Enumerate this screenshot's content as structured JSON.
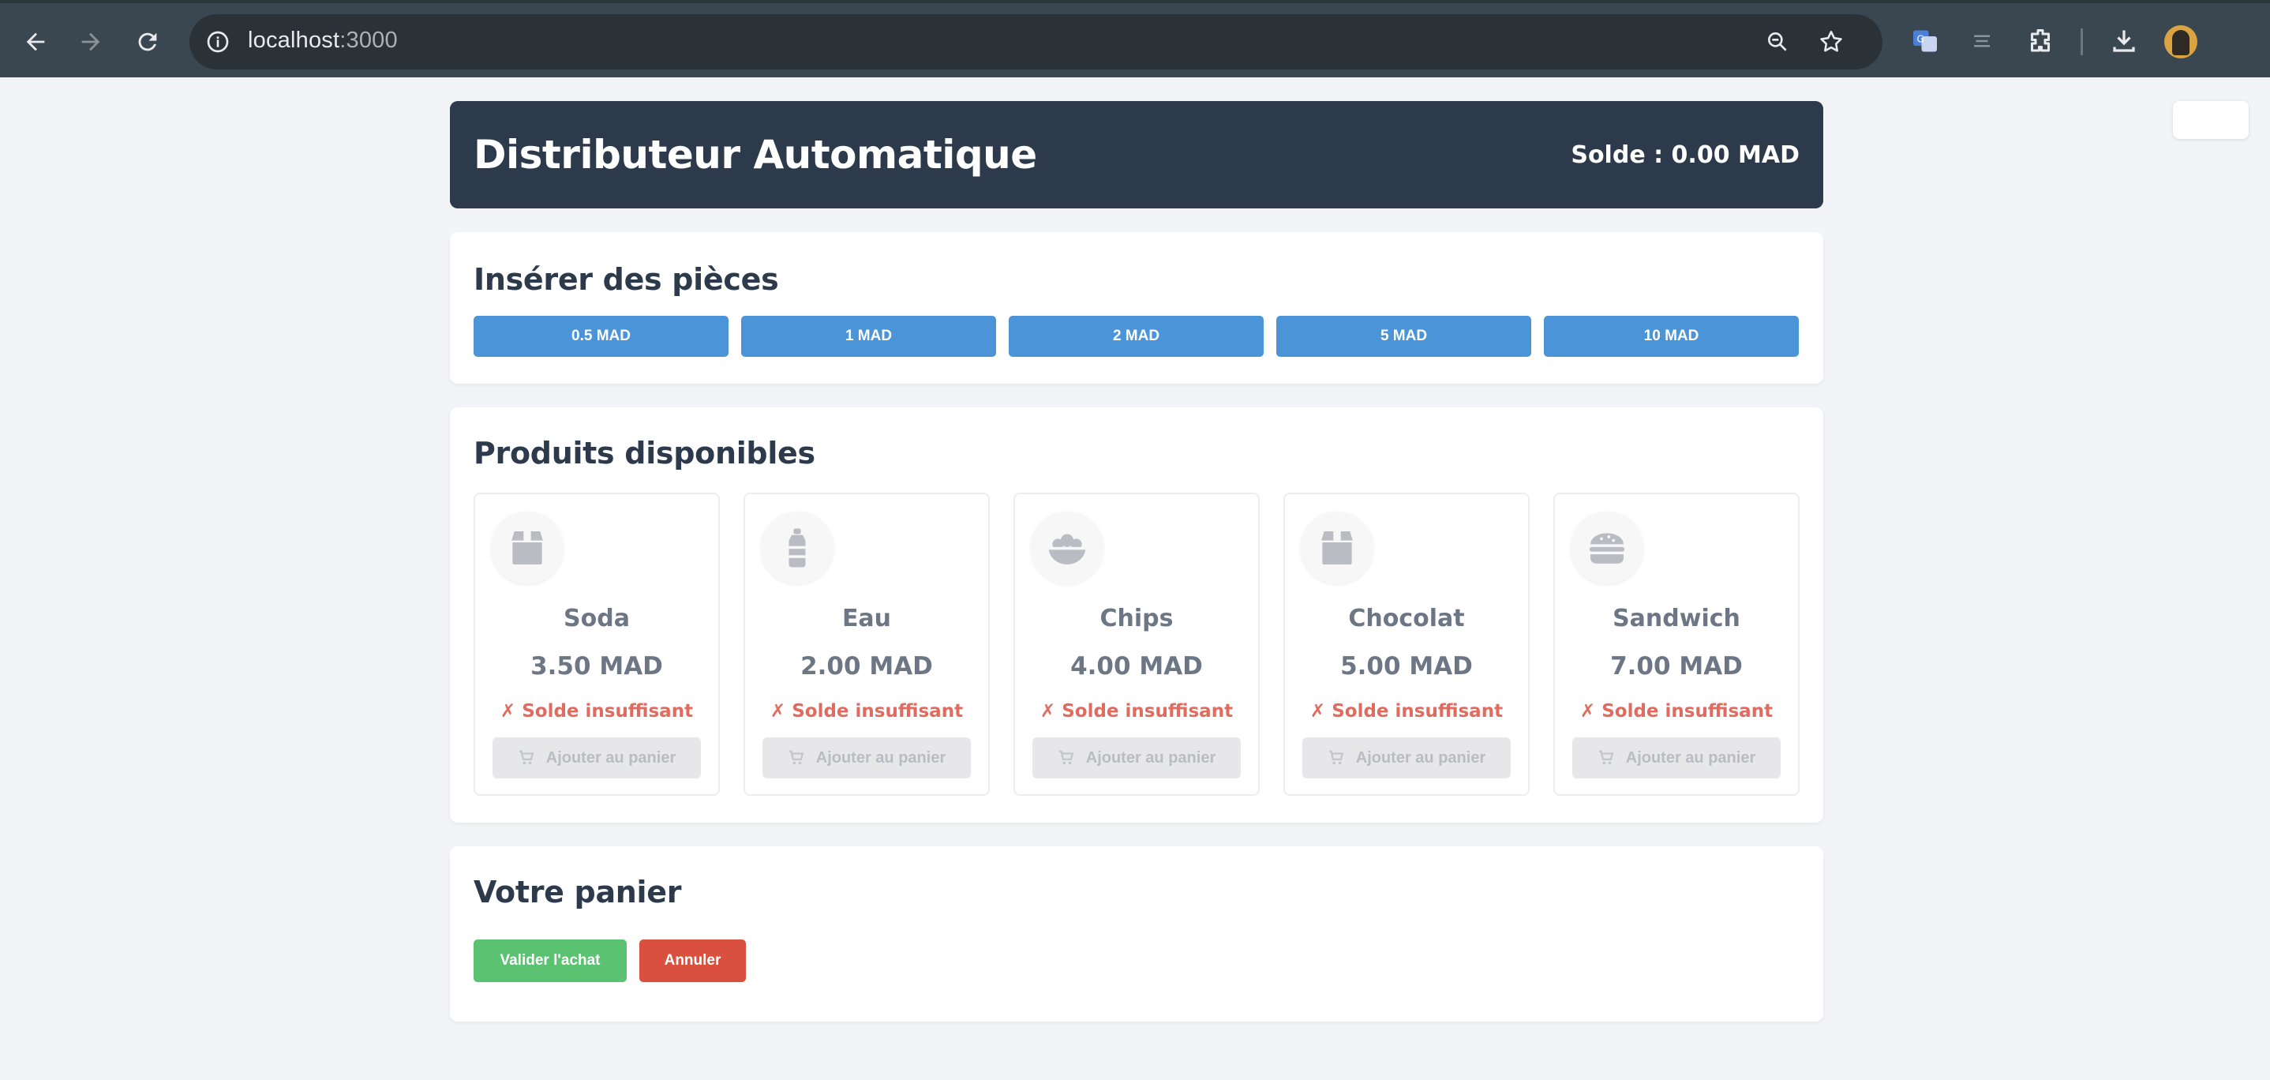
{
  "browser": {
    "url_host": "localhost",
    "url_port": ":3000"
  },
  "app": {
    "title": "Distributeur Automatique",
    "balance": "Solde : 0.00 MAD"
  },
  "coins": {
    "title": "Insérer des pièces",
    "buttons": [
      "0.5 MAD",
      "1 MAD",
      "2 MAD",
      "5 MAD",
      "10 MAD"
    ]
  },
  "products": {
    "title": "Produits disponibles",
    "items": [
      {
        "name": "Soda",
        "price": "3.50 MAD",
        "status": "✗ Solde insuffisant",
        "add_label": "Ajouter au panier",
        "icon": "box-icon"
      },
      {
        "name": "Eau",
        "price": "2.00 MAD",
        "status": "✗ Solde insuffisant",
        "add_label": "Ajouter au panier",
        "icon": "bottle-icon"
      },
      {
        "name": "Chips",
        "price": "4.00 MAD",
        "status": "✗ Solde insuffisant",
        "add_label": "Ajouter au panier",
        "icon": "bowl-icon"
      },
      {
        "name": "Chocolat",
        "price": "5.00 MAD",
        "status": "✗ Solde insuffisant",
        "add_label": "Ajouter au panier",
        "icon": "box-icon"
      },
      {
        "name": "Sandwich",
        "price": "7.00 MAD",
        "status": "✗ Solde insuffisant",
        "add_label": "Ajouter au panier",
        "icon": "burger-icon"
      }
    ]
  },
  "cart": {
    "title": "Votre panier",
    "validate_label": "Valider l'achat",
    "cancel_label": "Annuler"
  },
  "colors": {
    "header_bg": "#2d3a4b",
    "coin_button": "#4c94d8",
    "insufficient": "#e26b5f",
    "validate": "#5ac270",
    "cancel": "#d9503f"
  }
}
